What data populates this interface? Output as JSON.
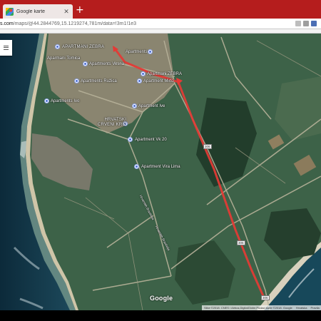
{
  "browser": {
    "tab_title": "Google karte",
    "tab_close": "✕",
    "new_tab": "+",
    "url_domain": "s.com",
    "url_path": "/maps/@44.2844769,15.1219274,781m/data=!3m1!1e3",
    "colors": {
      "tabstrip": "#b51d1d",
      "tab": "#eee7e6"
    }
  },
  "map": {
    "layer_button_icon": "menu-icon",
    "google_logo": "Google",
    "labels": [
      {
        "id": "apartmani-zebra",
        "text": "APARTMANI ZEBRA",
        "upper": true
      },
      {
        "id": "apartments-top",
        "text": "Apartments"
      },
      {
        "id": "aparmani-tomica",
        "text": "Aparmani Tomica"
      },
      {
        "id": "apartments-vesna",
        "text": "Apartments Vesna"
      },
      {
        "id": "apartmani-zebra-pin",
        "text": "Apartmani ZEBRA"
      },
      {
        "id": "apartments-ruzica",
        "text": "Apartments Ružica"
      },
      {
        "id": "apartment-mirto",
        "text": "Apartment Mirto"
      },
      {
        "id": "apartments-ivo",
        "text": "Apartments Ivo"
      },
      {
        "id": "apartment-ive",
        "text": "Apartment Ive"
      },
      {
        "id": "hrvatski-crveni-kriz",
        "text": "HRVATSKI\nCRVENI KRIŽ",
        "upper": true
      },
      {
        "id": "apartment-vk20",
        "text": "Apartment Vk 20"
      },
      {
        "id": "apartment-vira-lima",
        "text": "Apartment Vira Lima"
      },
      {
        "id": "road-1",
        "text": "Hrvatskih Branitelja"
      },
      {
        "id": "road-2",
        "text": "Hrvatskih Branitelja"
      }
    ],
    "road_shields": [
      "306",
      "306",
      "306"
    ],
    "attribution": [
      "Slike ©2018. CNES / Airbus,DigitalGlobe,Podaci karte ©2018. Google",
      "Hrvatska",
      "Pravila"
    ],
    "route_color": "#e53935"
  }
}
